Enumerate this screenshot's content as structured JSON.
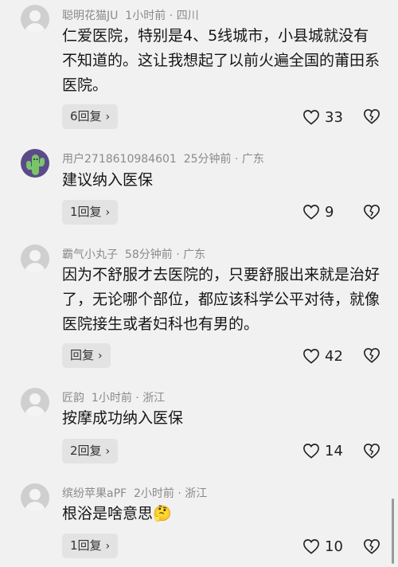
{
  "comments": [
    {
      "username": "聪明花猫JU",
      "time": "1小时前",
      "location": "四川",
      "text": "仁爱医院，特别是4、5线城市，小县城就没有不知道的。这让我想起了以前火遍全国的莆田系医院。",
      "reply_label": "6回复",
      "likes": "33"
    },
    {
      "username": "用户2718610984601",
      "time": "25分钟前",
      "location": "广东",
      "text": "建议纳入医保",
      "reply_label": "1回复",
      "likes": "9"
    },
    {
      "username": "霸气小丸子",
      "time": "58分钟前",
      "location": "广东",
      "text": "因为不舒服才去医院的，只要舒服出来就是治好了，无论哪个部位，都应该科学公平对待，就像医院接生或者妇科也有男的。",
      "reply_label": "回复",
      "likes": "42"
    },
    {
      "username": "匠韵",
      "time": "1小时前",
      "location": "浙江",
      "text": "按摩成功纳入医保",
      "reply_label": "2回复",
      "likes": "14"
    },
    {
      "username": "缤纷苹果aPF",
      "time": "2小时前",
      "location": "浙江",
      "text": "根浴是啥意思",
      "emoji": "🤔",
      "reply_label": "1回复",
      "likes": "10"
    }
  ],
  "separator": "·",
  "chevron": "›"
}
